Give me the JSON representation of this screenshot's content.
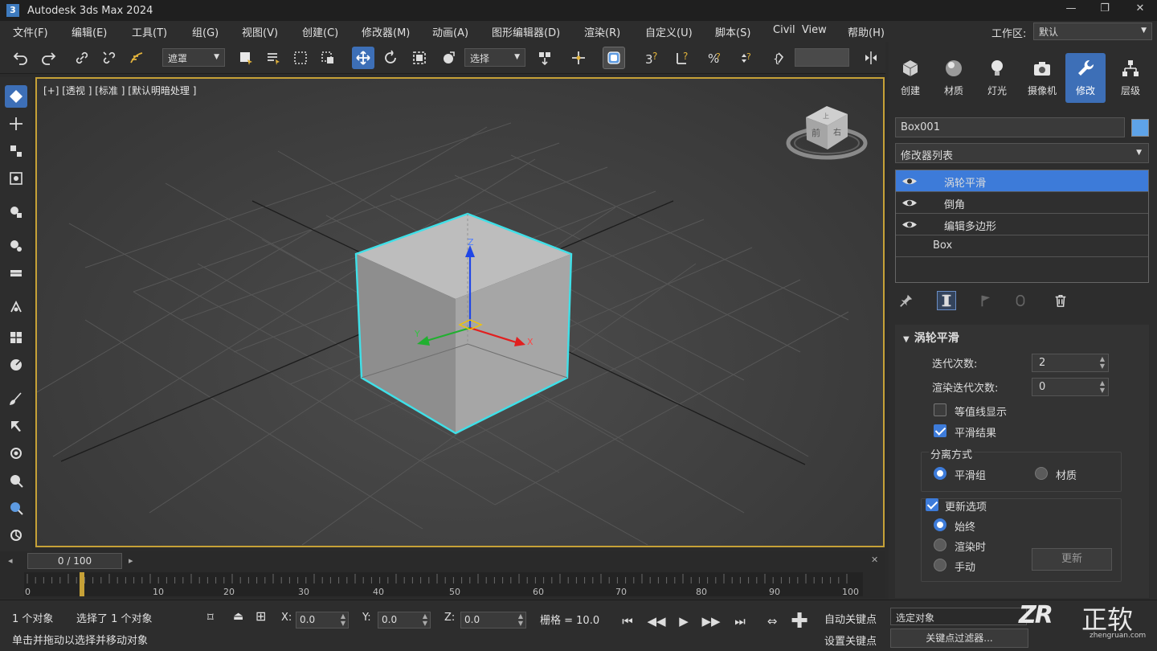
{
  "window": {
    "title": "Autodesk 3ds Max 2024",
    "minimize": "—",
    "maximize": "❐",
    "close": "✕",
    "app_icon": "3"
  },
  "menu": {
    "items": [
      "文件(F)",
      "编辑(E)",
      "工具(T)",
      "组(G)",
      "视图(V)",
      "创建(C)",
      "修改器(M)",
      "动画(A)",
      "图形编辑器(D)",
      "渲染(R)",
      "自定义(U)",
      "脚本(S)",
      "Civil  View",
      "帮助(H)"
    ],
    "workspace_label": "工作区:",
    "workspace_value": "默认"
  },
  "toolbar": {
    "selection_filter": "选择",
    "ref_coord": "选择",
    "filter_visible": "遮罩",
    "coord_visible": "选择"
  },
  "viewport": {
    "label": "[+] [透视 ] [标准 ] [默认明暗处理 ]",
    "viewcube_front": "前",
    "viewcube_right": "右",
    "viewcube_top": "上",
    "axis_x": "X",
    "axis_y": "Y",
    "axis_z": "Z"
  },
  "timeline": {
    "slider": "0  /  100",
    "ticks": [
      "0",
      "10",
      "20",
      "30",
      "40",
      "50",
      "60",
      "70",
      "80",
      "90",
      "100"
    ]
  },
  "status": {
    "objects": "1 个对象",
    "selected": "选择了 1 个对象",
    "hint": "单击并拖动以选择并移动对象",
    "x_label": "X:",
    "x_value": "0.0",
    "y_label": "Y:",
    "y_value": "0.0",
    "z_label": "Z:",
    "z_value": "0.0",
    "grid": "栅格 = 10.0",
    "auto_key": "自动关键点",
    "set_key": "设置关键点",
    "selected_object": "选定对象",
    "key_filters": "关键点过滤器..."
  },
  "command_panel": {
    "tabs": [
      {
        "label": "创建",
        "icon": "create-icon"
      },
      {
        "label": "材质",
        "icon": "material-icon"
      },
      {
        "label": "灯光",
        "icon": "light-icon"
      },
      {
        "label": "摄像机",
        "icon": "camera-icon"
      },
      {
        "label": "修改",
        "icon": "wrench-icon"
      },
      {
        "label": "层级",
        "icon": "hierarchy-icon"
      }
    ],
    "object_name": "Box001",
    "object_color": "#5ea3e8",
    "modifier_list": "修改器列表",
    "stack": [
      {
        "label": "涡轮平滑",
        "selected": true
      },
      {
        "label": "倒角",
        "selected": false
      },
      {
        "label": "编辑多边形",
        "selected": false
      },
      {
        "label": "Box",
        "selected": false
      }
    ],
    "rollout": {
      "title": "涡轮平滑",
      "iterations_label": "迭代次数:",
      "iterations_value": "2",
      "render_iters_label": "渲染迭代次数:",
      "render_iters_value": "0",
      "isoline_label": "等值线显示",
      "smooth_result_label": "平滑结果",
      "separate_by_label": "分离方式",
      "smoothing_groups_label": "平滑组",
      "materials_label": "材质",
      "update_options_label": "更新选项",
      "always_label": "始终",
      "when_rendering_label": "渲染时",
      "manually_label": "手动",
      "update_button": "更新"
    }
  },
  "watermark": {
    "brand": "正软",
    "logo": "ZR",
    "url": "zhengruan.com"
  },
  "colors": {
    "accent": "#3d7bd9",
    "viewport_border": "#c6a137",
    "selection_outline": "#3fe0e8"
  }
}
